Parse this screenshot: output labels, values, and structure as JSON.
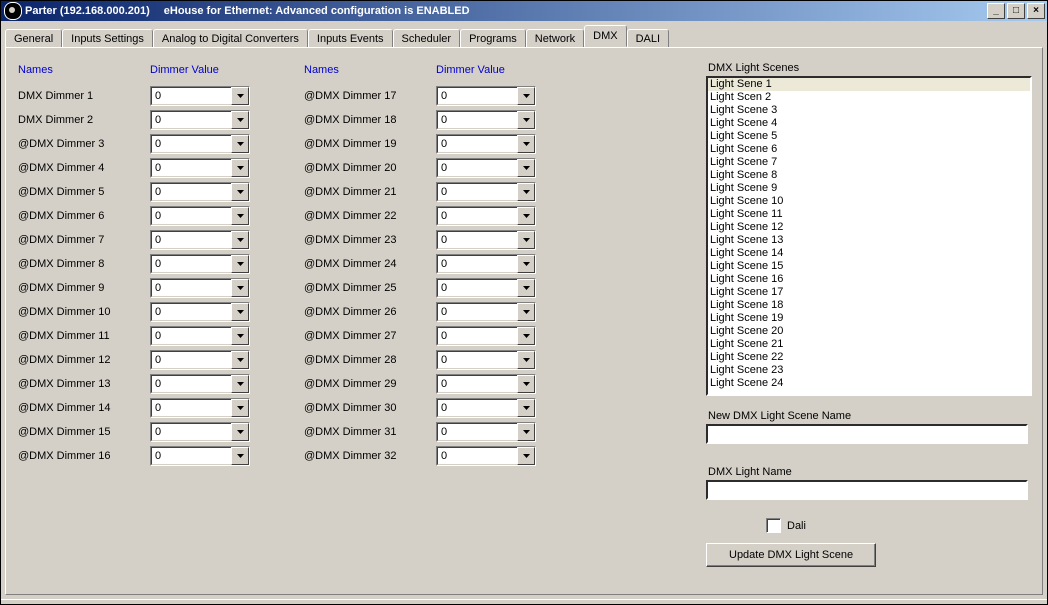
{
  "window": {
    "title_left": "Parter (192.168.000.201)",
    "title_right": "eHouse for Ethernet: Advanced configuration is ENABLED"
  },
  "tabs": [
    "General",
    "Inputs Settings",
    "Analog to Digital Converters",
    "Inputs Events",
    "Scheduler",
    "Programs",
    "Network",
    "DMX",
    "DALI"
  ],
  "active_tab": "DMX",
  "headers": {
    "names": "Names",
    "dimmer_value": "Dimmer Value"
  },
  "dimmers_left": [
    {
      "name": "DMX Dimmer 1",
      "value": "0"
    },
    {
      "name": "DMX Dimmer 2",
      "value": "0"
    },
    {
      "name": "@DMX Dimmer 3",
      "value": "0"
    },
    {
      "name": "@DMX Dimmer 4",
      "value": "0"
    },
    {
      "name": "@DMX Dimmer 5",
      "value": "0"
    },
    {
      "name": "@DMX Dimmer 6",
      "value": "0"
    },
    {
      "name": "@DMX Dimmer 7",
      "value": "0"
    },
    {
      "name": "@DMX Dimmer 8",
      "value": "0"
    },
    {
      "name": "@DMX Dimmer 9",
      "value": "0"
    },
    {
      "name": "@DMX Dimmer 10",
      "value": "0"
    },
    {
      "name": "@DMX Dimmer 11",
      "value": "0"
    },
    {
      "name": "@DMX Dimmer 12",
      "value": "0"
    },
    {
      "name": "@DMX Dimmer 13",
      "value": "0"
    },
    {
      "name": "@DMX Dimmer 14",
      "value": "0"
    },
    {
      "name": "@DMX Dimmer 15",
      "value": "0"
    },
    {
      "name": "@DMX Dimmer 16",
      "value": "0"
    }
  ],
  "dimmers_right": [
    {
      "name": "@DMX Dimmer 17",
      "value": "0"
    },
    {
      "name": "@DMX Dimmer 18",
      "value": "0"
    },
    {
      "name": "@DMX Dimmer 19",
      "value": "0"
    },
    {
      "name": "@DMX Dimmer 20",
      "value": "0"
    },
    {
      "name": "@DMX Dimmer 21",
      "value": "0"
    },
    {
      "name": "@DMX Dimmer 22",
      "value": "0"
    },
    {
      "name": "@DMX Dimmer 23",
      "value": "0"
    },
    {
      "name": "@DMX Dimmer 24",
      "value": "0"
    },
    {
      "name": "@DMX Dimmer 25",
      "value": "0"
    },
    {
      "name": "@DMX Dimmer 26",
      "value": "0"
    },
    {
      "name": "@DMX Dimmer 27",
      "value": "0"
    },
    {
      "name": "@DMX Dimmer 28",
      "value": "0"
    },
    {
      "name": "@DMX Dimmer 29",
      "value": "0"
    },
    {
      "name": "@DMX Dimmer 30",
      "value": "0"
    },
    {
      "name": "@DMX Dimmer 31",
      "value": "0"
    },
    {
      "name": "@DMX Dimmer 32",
      "value": "0"
    }
  ],
  "scenes": {
    "label": "DMX Light Scenes",
    "items": [
      "Light Sene 1",
      "Light Scen 2",
      "Light Scene 3",
      "Light Scene 4",
      "Light Scene 5",
      "Light Scene 6",
      "Light Scene 7",
      "Light Scene 8",
      "Light Scene 9",
      "Light Scene 10",
      "Light Scene 11",
      "Light Scene 12",
      "Light Scene 13",
      "Light Scene 14",
      "Light Scene 15",
      "Light Scene 16",
      "Light Scene 17",
      "Light Scene 18",
      "Light Scene 19",
      "Light Scene 20",
      "Light Scene 21",
      "Light Scene 22",
      "Light Scene 23",
      "Light Scene 24"
    ],
    "selected_index": 0
  },
  "new_scene_label": "New DMX Light Scene Name",
  "new_scene_value": "",
  "light_name_label": "DMX Light Name",
  "light_name_value": "",
  "dali_checkbox_label": "Dali",
  "dali_checked": false,
  "update_button": "Update DMX Light Scene"
}
